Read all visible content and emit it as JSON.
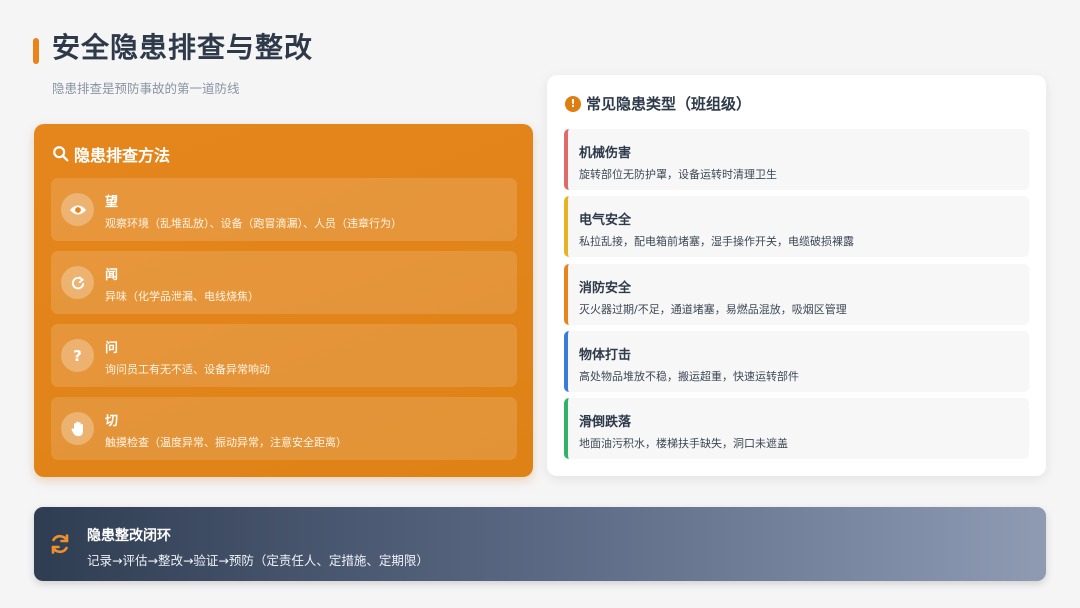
{
  "header": {
    "title": "安全隐患排查与整改",
    "subtitle": "隐患排查是预防事故的第一道防线",
    "accent_color": "#e8841a"
  },
  "methods": {
    "title": "隐患排查方法",
    "items": [
      {
        "icon": "eye-icon",
        "title": "望",
        "desc": "观察环境（乱堆乱放）、设备（跑冒滴漏）、人员（违章行为）"
      },
      {
        "icon": "refresh-icon",
        "title": "闻",
        "desc": "异味（化学品泄漏、电线烧焦）"
      },
      {
        "icon": "question-icon",
        "title": "问",
        "desc": "询问员工有无不适、设备异常响动"
      },
      {
        "icon": "hand-icon",
        "title": "切",
        "desc": "触摸检查（温度异常、振动异常，注意安全距离）"
      }
    ]
  },
  "types": {
    "title": "常见隐患类型（班组级）",
    "items": [
      {
        "title": "机械伤害",
        "desc": "旋转部位无防护罩，设备运转时清理卫生",
        "color": "#e06a6a"
      },
      {
        "title": "电气安全",
        "desc": "私拉乱接，配电箱前堵塞，湿手操作开关，电缆破损裸露",
        "color": "#e6b422"
      },
      {
        "title": "消防安全",
        "desc": "灭火器过期/不足，通道堵塞，易燃品混放，吸烟区管理",
        "color": "#e8841a"
      },
      {
        "title": "物体打击",
        "desc": "高处物品堆放不稳，搬运超重，快速运转部件",
        "color": "#3a7bd5"
      },
      {
        "title": "滑倒跌落",
        "desc": "地面油污积水，楼梯扶手缺失，洞口未遮盖",
        "color": "#2fb36a"
      }
    ]
  },
  "loop": {
    "title": "隐患整改闭环",
    "desc": "记录→评估→整改→验证→预防（定责任人、定措施、定期限）",
    "icon": "cycle-icon"
  }
}
